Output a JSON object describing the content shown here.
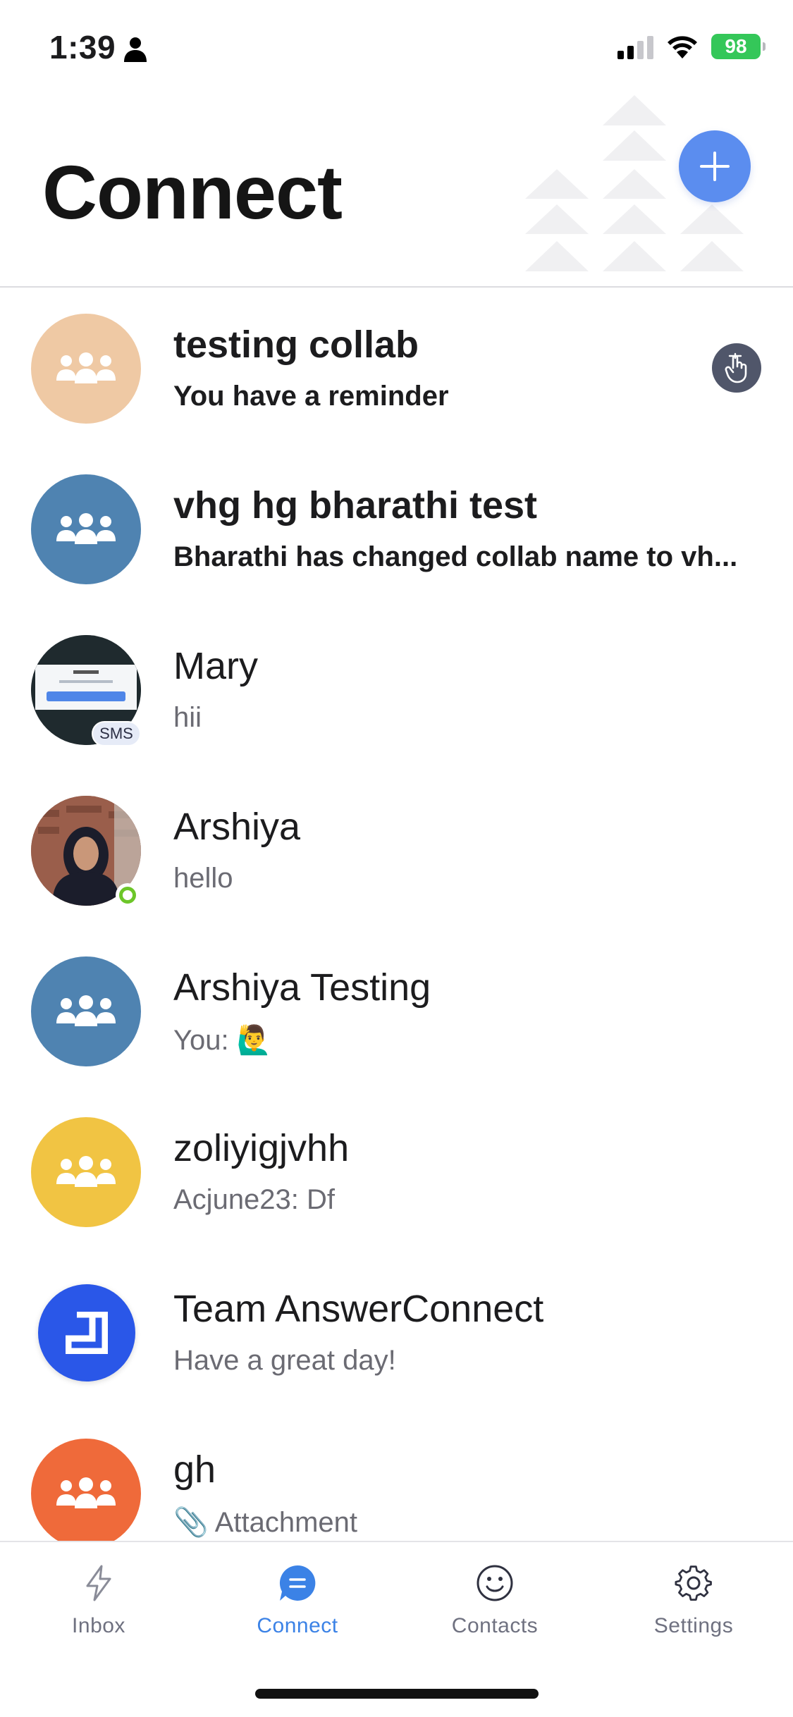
{
  "status_bar": {
    "time": "1:39",
    "battery": "98"
  },
  "header": {
    "title": "Connect"
  },
  "colors": {
    "accent": "#3b82e6",
    "fab": "#5b8def",
    "online": "#6dc629"
  },
  "conversations": [
    {
      "title": "testing collab",
      "subtitle": "You have a reminder",
      "avatar_color": "#efc9a4",
      "avatar_type": "group",
      "unread": true,
      "badge_icon": "reminder-hand-icon"
    },
    {
      "title": "vhg hg bharathi test",
      "subtitle": "Bharathi has changed collab name to vh...",
      "avatar_color": "#4f83b1",
      "avatar_type": "group",
      "unread": true
    },
    {
      "title": "Mary",
      "subtitle": "hii",
      "avatar_type": "photo-screenshot",
      "badge": "SMS"
    },
    {
      "title": "Arshiya",
      "subtitle": "hello",
      "avatar_type": "photo",
      "online": true
    },
    {
      "title": "Arshiya Testing",
      "subtitle": "You: 🙋‍♂️",
      "avatar_color": "#4f83b1",
      "avatar_type": "group"
    },
    {
      "title": "zoliyigjvhh",
      "subtitle": "Acjune23: Df",
      "avatar_color": "#f1c443",
      "avatar_type": "group"
    },
    {
      "title": "Team AnswerConnect",
      "subtitle": "Have a great day!",
      "avatar_color": "#2a57e8",
      "avatar_type": "logo"
    },
    {
      "title": "gh",
      "subtitle": "📎 Attachment",
      "avatar_color": "#ef6a3a",
      "avatar_type": "group"
    }
  ],
  "tabs": [
    {
      "label": "Inbox",
      "icon": "bolt-icon",
      "active": false
    },
    {
      "label": "Connect",
      "icon": "chat-bubble-icon",
      "active": true
    },
    {
      "label": "Contacts",
      "icon": "smiley-icon",
      "active": false
    },
    {
      "label": "Settings",
      "icon": "gear-icon",
      "active": false
    }
  ]
}
